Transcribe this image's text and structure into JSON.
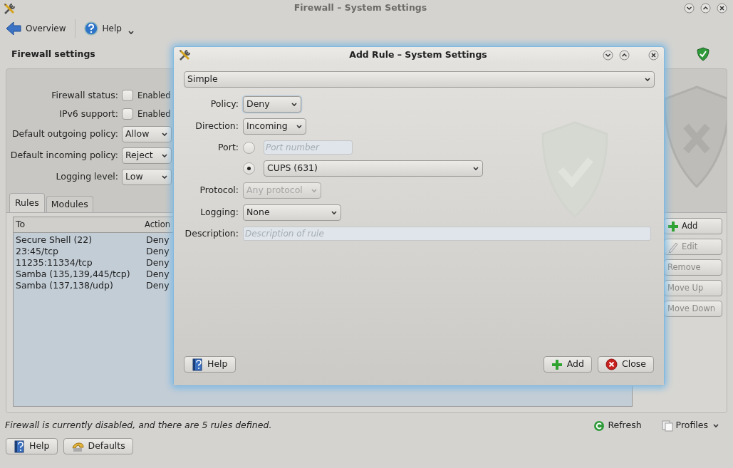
{
  "window": {
    "title": "Firewall – System Settings"
  },
  "toolbar": [
    {
      "kind": "back",
      "label": "Overview"
    },
    {
      "kind": "help",
      "label": "Help"
    }
  ],
  "page_title": "Firewall settings",
  "settings": [
    {
      "kind": "checkbox",
      "label": "Firewall status:",
      "text": "Enabled",
      "checked": false
    },
    {
      "kind": "checkbox",
      "label": "IPv6 support:",
      "text": "Enabled",
      "checked": false
    },
    {
      "kind": "select",
      "label": "Default outgoing policy:",
      "value": "Allow"
    },
    {
      "kind": "select",
      "label": "Default incoming policy:",
      "value": "Reject"
    },
    {
      "kind": "select",
      "label": "Logging level:",
      "value": "Low"
    }
  ],
  "tabs": [
    {
      "label": "Rules",
      "selected": true
    },
    {
      "label": "Modules",
      "selected": false
    }
  ],
  "rules_table": {
    "columns": [
      "To",
      "Action"
    ],
    "rows": [
      [
        "Secure Shell (22)",
        "Deny"
      ],
      [
        "23:45/tcp",
        "Deny"
      ],
      [
        "11235:11334/tcp",
        "Deny"
      ],
      [
        "Samba (135,139,445/tcp)",
        "Deny"
      ],
      [
        "Samba (137,138/udp)",
        "Deny"
      ]
    ]
  },
  "side_buttons": [
    {
      "kind": "add",
      "label": "Add",
      "disabled": false
    },
    {
      "kind": "edit",
      "label": "Edit",
      "disabled": true
    },
    {
      "kind": "plain",
      "label": "Remove",
      "disabled": true
    },
    {
      "kind": "plain",
      "label": "Move Up",
      "disabled": true
    },
    {
      "kind": "plain",
      "label": "Move Down",
      "disabled": true
    }
  ],
  "status_text": "Firewall is currently disabled, and there are 5 rules defined.",
  "refresh_label": "Refresh",
  "profiles_label": "Profiles",
  "bottom_buttons": [
    {
      "kind": "help",
      "label": "Help"
    },
    {
      "kind": "defaults",
      "label": "Defaults"
    }
  ],
  "dialog": {
    "title": "Add Rule – System Settings",
    "mode": "Simple",
    "fields": [
      {
        "kind": "select",
        "label": "Policy:",
        "value": "Deny",
        "focused": true,
        "disabled": false
      },
      {
        "kind": "select",
        "label": "Direction:",
        "value": "Incoming",
        "focused": false,
        "disabled": false
      },
      {
        "kind": "radio-input",
        "label": "Port:",
        "selected": false,
        "placeholder": "Port number"
      },
      {
        "kind": "radio-select",
        "selected": true,
        "value": "CUPS (631)"
      },
      {
        "kind": "select",
        "label": "Protocol:",
        "value": "Any protocol",
        "focused": false,
        "disabled": true
      },
      {
        "kind": "select",
        "label": "Logging:",
        "value": "None",
        "focused": false,
        "disabled": false
      },
      {
        "kind": "input",
        "label": "Description:",
        "placeholder": "Description of rule"
      }
    ],
    "buttons": [
      {
        "kind": "help",
        "label": "Help"
      },
      {
        "kind": "add",
        "label": "Add"
      },
      {
        "kind": "close",
        "label": "Close"
      }
    ]
  }
}
